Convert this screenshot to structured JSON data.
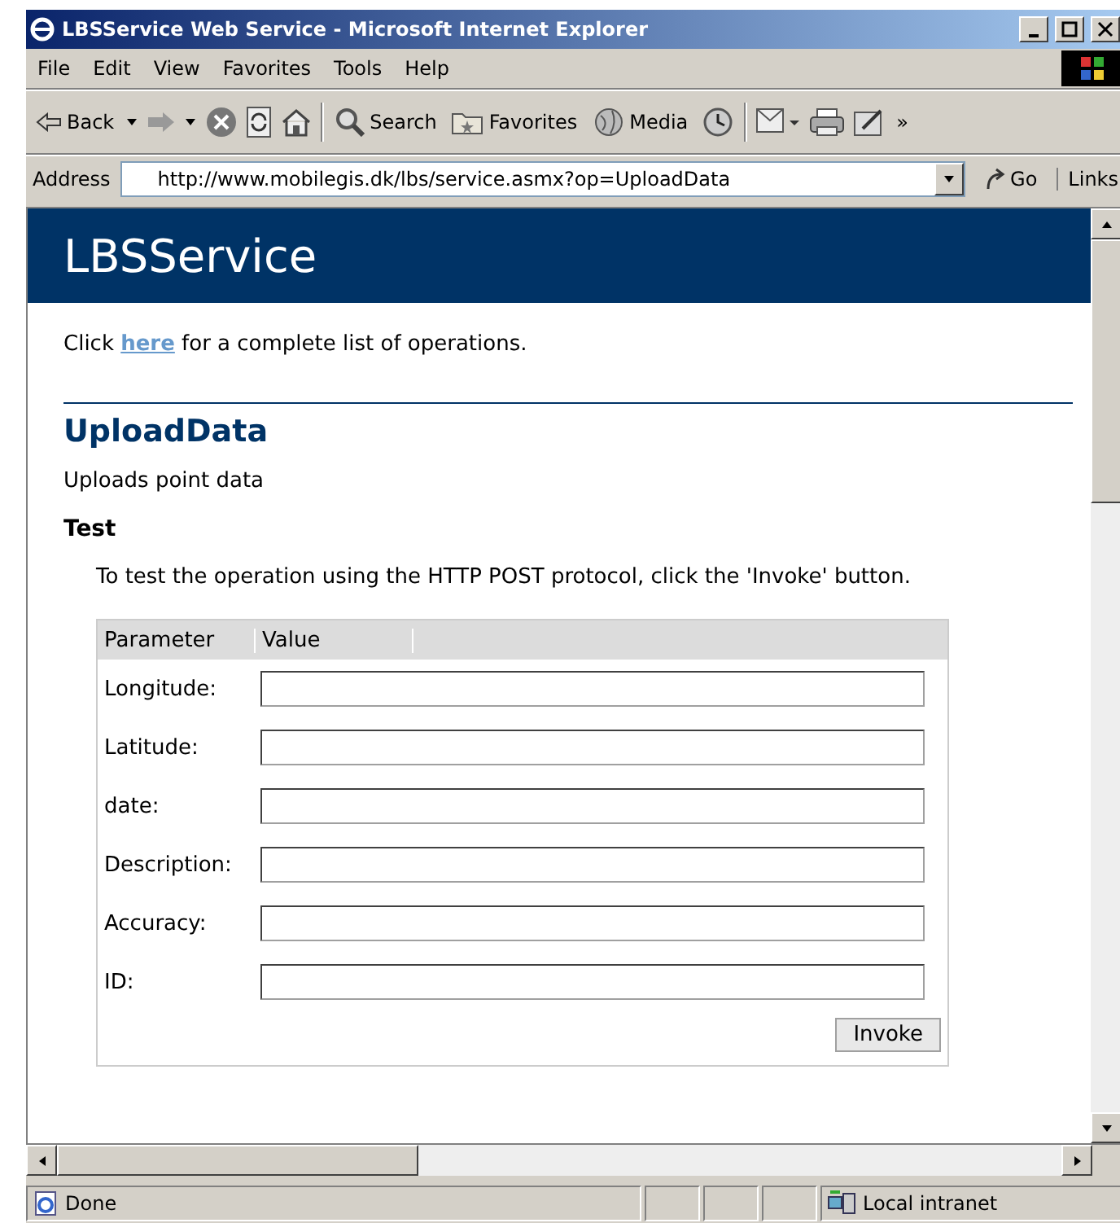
{
  "window": {
    "title": "LBSService Web Service - Microsoft Internet Explorer"
  },
  "menu": [
    "File",
    "Edit",
    "View",
    "Favorites",
    "Tools",
    "Help"
  ],
  "toolbar": [
    {
      "kind": "back",
      "label": "Back"
    },
    {
      "kind": "forward"
    },
    {
      "kind": "stop"
    },
    {
      "kind": "refresh"
    },
    {
      "kind": "home"
    },
    {
      "kind": "sep"
    },
    {
      "kind": "search",
      "label": "Search"
    },
    {
      "kind": "favorites",
      "label": "Favorites"
    },
    {
      "kind": "media",
      "label": "Media"
    },
    {
      "kind": "history"
    },
    {
      "kind": "sep"
    },
    {
      "kind": "mail"
    },
    {
      "kind": "print"
    },
    {
      "kind": "edit"
    },
    {
      "kind": "more",
      "label": "»"
    }
  ],
  "address": {
    "label": "Address",
    "value": "http://www.mobilegis.dk/lbs/service.asmx?op=UploadData",
    "go": "Go",
    "links": "Links"
  },
  "page": {
    "banner": "LBSService",
    "intro_parts": [
      "Click ",
      "here",
      " for a complete list of operations."
    ],
    "operation": "UploadData",
    "description": "Uploads point data",
    "test_heading": "Test",
    "test_text": "To test the operation using the HTTP POST protocol, click the 'Invoke' button.",
    "table": {
      "columns": [
        "Parameter",
        "Value"
      ],
      "rows": [
        {
          "name": "Longitude:"
        },
        {
          "name": "Latitude:"
        },
        {
          "name": "date:"
        },
        {
          "name": "Description:"
        },
        {
          "name": "Accuracy:"
        },
        {
          "name": "ID:"
        }
      ]
    },
    "button": "Invoke"
  },
  "status_bar": {
    "text": "Done",
    "zone": "Local intranet"
  }
}
